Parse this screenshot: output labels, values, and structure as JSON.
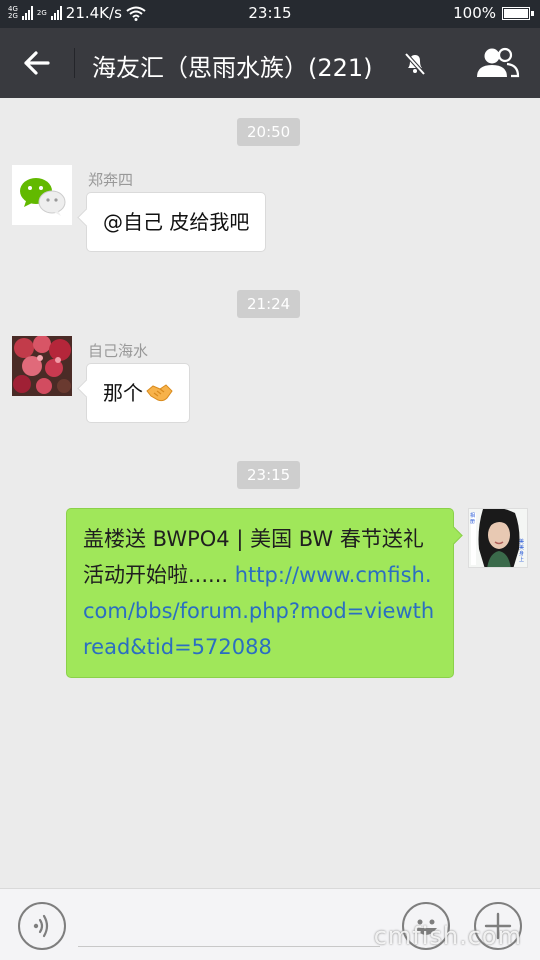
{
  "status_bar": {
    "net_label_top": "4G",
    "net_label_bottom": "2G",
    "speed": "21.4K/s",
    "time": "23:15",
    "battery": "100%",
    "battery_level": 1.0
  },
  "title_bar": {
    "title": "海友汇（思雨水族）(221)"
  },
  "messages": [
    {
      "timestamp": "20:50",
      "sender": "郑奔四",
      "text": "@自己  皮给我吧"
    },
    {
      "timestamp": "21:24",
      "sender": "自己海水",
      "text": "那个"
    },
    {
      "timestamp": "23:15",
      "text_plain": "盖楼送 BWPO4 | 美国 BW 春节送礼活动开始啦......",
      "text_link": "http://www.cmfish.com/bbs/forum.php?mod=viewthread&tid=572088"
    }
  ],
  "avatar_text": {
    "left": "相册",
    "right": "美美身上"
  },
  "colors": {
    "title_bg": "#393a3f",
    "chat_bg": "#ebebeb",
    "out_bubble": "#a0e75a",
    "link": "#2b6ec1"
  },
  "icons": [
    "back-arrow-icon",
    "mute-bell-icon",
    "group-members-icon",
    "voice-icon",
    "emoji-icon",
    "plus-icon",
    "handshake-emoji-icon"
  ],
  "watermark": "cmfish.com"
}
